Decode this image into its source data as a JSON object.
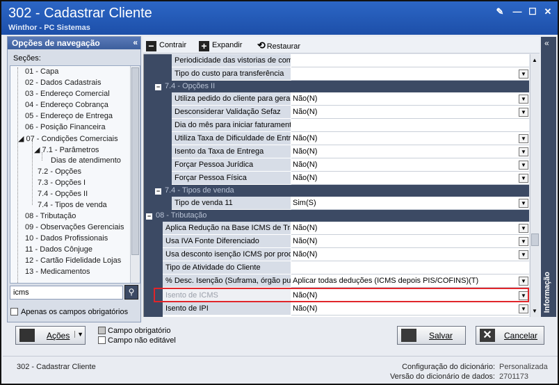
{
  "window": {
    "title": "302 - Cadastrar Cliente",
    "subtitle": "Winthor - PC Sistemas"
  },
  "nav": {
    "header": "Opções de navegação",
    "sections_label": "Seções:",
    "tree": [
      {
        "label": "01 - Capa"
      },
      {
        "label": "02 - Dados Cadastrais"
      },
      {
        "label": "03 - Endereço Comercial"
      },
      {
        "label": "04 - Endereço Cobrança"
      },
      {
        "label": "05 - Endereço de Entrega"
      },
      {
        "label": "06 - Posição Financeira"
      },
      {
        "label": "07 - Condições Comerciais"
      },
      {
        "label": "7.1 - Parâmetros"
      },
      {
        "label": "Dias de atendimento"
      },
      {
        "label": "7.2 - Opções"
      },
      {
        "label": "7.3 - Opções I"
      },
      {
        "label": "7.4 - Opções II"
      },
      {
        "label": "7.4 - Tipos de venda"
      },
      {
        "label": "08 - Tributação"
      },
      {
        "label": "09 - Observações Gerenciais"
      },
      {
        "label": "10 - Dados Profissionais"
      },
      {
        "label": "11 - Dados Cônjuge"
      },
      {
        "label": "12 - Cartão Fidelidade Lojas"
      },
      {
        "label": "13 - Medicamentos"
      }
    ],
    "search_value": "icms",
    "only_required_label": "Apenas os campos obrigatórios"
  },
  "toolbar": {
    "collapse_label": "Contrair",
    "expand_label": "Expandir",
    "restore_label": "Restaurar"
  },
  "grid": {
    "rows_top": [
      {
        "label": "Periodicidade das vistorias de com",
        "value": ""
      },
      {
        "label": "Tipo do custo  para transferência",
        "value": ""
      }
    ],
    "group_opcoes_ii": "7.4 - Opções II",
    "rows_opcoes_ii": [
      {
        "label": "Utiliza pedido do cliente para gerac",
        "value": "Não(N)"
      },
      {
        "label": "Desconsiderar Validação Sefaz",
        "value": "Não(N)"
      },
      {
        "label": "Dia do mês para iniciar faturament",
        "value": ""
      },
      {
        "label": "Utiliza Taxa de Dificuldade de Entr",
        "value": "Não(N)"
      },
      {
        "label": "Isento da Taxa de Entrega",
        "value": "Não(N)"
      },
      {
        "label": "Forçar Pessoa Jurídica",
        "value": "Não(N)"
      },
      {
        "label": "Forçar Pessoa Física",
        "value": "Não(N)"
      }
    ],
    "group_tipos_venda": "7.4 - Tipos de venda",
    "rows_tipos_venda": [
      {
        "label": "Tipo de venda 11",
        "value": "Sim(S)"
      }
    ],
    "group_tributacao": "08 - Tributação",
    "rows_tributacao": [
      {
        "label": "Aplica Redução na Base ICMS de Trar",
        "value": "Não(N)"
      },
      {
        "label": "Usa IVA Fonte Diferenciado",
        "value": "Não(N)"
      },
      {
        "label": "Usa desconto isenção ICMS por produ",
        "value": "Não(N)"
      },
      {
        "label": "Tipo de Atividade do Cliente",
        "value": ""
      },
      {
        "label": "% Desc. Isenção (Suframa, órgão pu",
        "value": "Aplicar todas deduções (ICMS depois PIS/COFINS)(T)"
      },
      {
        "label": "Isento de ICMS",
        "value": "Não(N)"
      },
      {
        "label": "Isento de IPI",
        "value": "Não(N)"
      }
    ]
  },
  "info_tab": "Informação",
  "bottom": {
    "actions_label": "Ações",
    "legend_required": "Campo obrigatório",
    "legend_not_editable": "Campo não editável",
    "save_label": "Salvar",
    "cancel_label": "Cancelar"
  },
  "status": {
    "left": "302 - Cadastrar Cliente",
    "dict_config_label": "Configuração do dicionário:",
    "dict_config_value": "Personalizada",
    "dict_version_label": "Versão do dicionário de dados:",
    "dict_version_value": "2701173"
  }
}
